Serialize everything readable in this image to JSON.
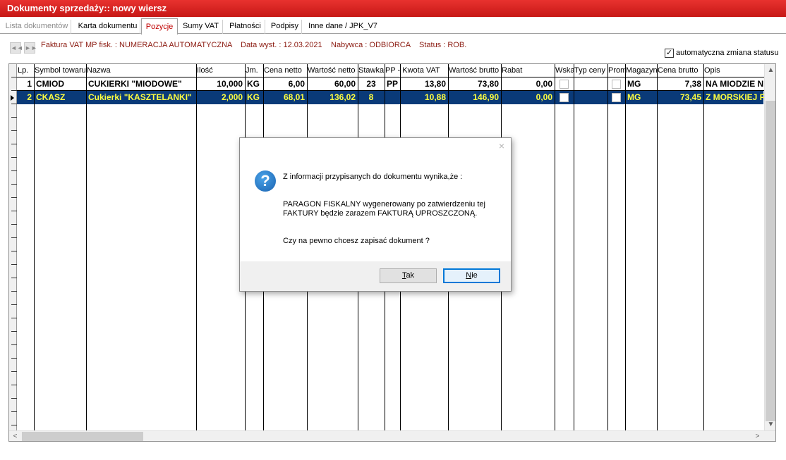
{
  "window": {
    "title": "Dokumenty sprzedaży:: nowy wiersz"
  },
  "tabs": [
    {
      "label": "Lista dokumentów",
      "state": "disabled"
    },
    {
      "label": "Karta dokumentu",
      "state": "normal"
    },
    {
      "label": "Pozycje",
      "state": "active"
    },
    {
      "label": "Sumy VAT",
      "state": "normal"
    },
    {
      "label": "Płatności",
      "state": "normal"
    },
    {
      "label": "Podpisy",
      "state": "normal"
    },
    {
      "label": "Inne dane / JPK_V7",
      "state": "normal"
    }
  ],
  "info": {
    "document": "Faktura VAT MP fisk. : NUMERACJA AUTOMATYCZNA",
    "date": "Data wyst. : 12.03.2021",
    "buyer": "Nabywca : ODBIORCA",
    "status": "Status : ROB.",
    "auto_status_label": "automatyczna zmiana statusu",
    "auto_status_checked": true
  },
  "grid": {
    "headers": [
      "Lp.",
      "Symbol towaru",
      "Nazwa",
      "Ilość",
      "Jm.",
      "Cena netto",
      "Wartość netto",
      "Stawka",
      "PP - Kwota VAT",
      "Wartość brutto",
      "Rabat",
      "Wska",
      "Typ ceny",
      "Prom",
      "Magazyn",
      "Cena brutto",
      "Opis"
    ],
    "rows": [
      {
        "lp": "1",
        "symbol": "CMIOD",
        "name": "CUKIERKI \"MIODOWE\"",
        "qty": "10,000",
        "unit": "KG",
        "net_price": "6,00",
        "net_value": "60,00",
        "rate": "23",
        "pp": "PP",
        "vat": "13,80",
        "gross_value": "73,80",
        "discount": "0,00",
        "warehouse": "MG",
        "gross_price": "7,38",
        "desc": "NA MIODZIE N"
      },
      {
        "lp": "2",
        "symbol": "CKASZ",
        "name": "Cukierki \"KASZTELANKI\"",
        "qty": "2,000",
        "unit": "KG",
        "net_price": "68,01",
        "net_value": "136,02",
        "rate": "8",
        "pp": "",
        "vat": "10,88",
        "gross_value": "146,90",
        "discount": "0,00",
        "warehouse": "MG",
        "gross_price": "73,45",
        "desc": "Z MORSKIEJ F"
      }
    ]
  },
  "dialog": {
    "line1": "Z informacji przypisanych do dokumentu wynika,że :",
    "line2": "PARAGON FISKALNY wygenerowany po zatwierdzeniu tej",
    "line3": "FAKTURY będzie zarazem FAKTURĄ UPROSZCZONĄ.",
    "line4": "Czy na pewno chcesz zapisać dokument ?",
    "yes_rest": "ak",
    "yes_key": "T",
    "no_rest": "ie",
    "no_key": "N",
    "close": "×"
  },
  "colors": {
    "title_bar": "#d51f1d",
    "selection": "#0a3a78",
    "selection_text": "#ffff40",
    "info_text": "#8b1a10"
  },
  "icons": {
    "nav_first": "◄◄",
    "nav_next": "►►",
    "question": "?",
    "check": "✓",
    "scroll_up": "▲",
    "scroll_down": "▼",
    "scroll_left": "<",
    "scroll_right": ">"
  }
}
